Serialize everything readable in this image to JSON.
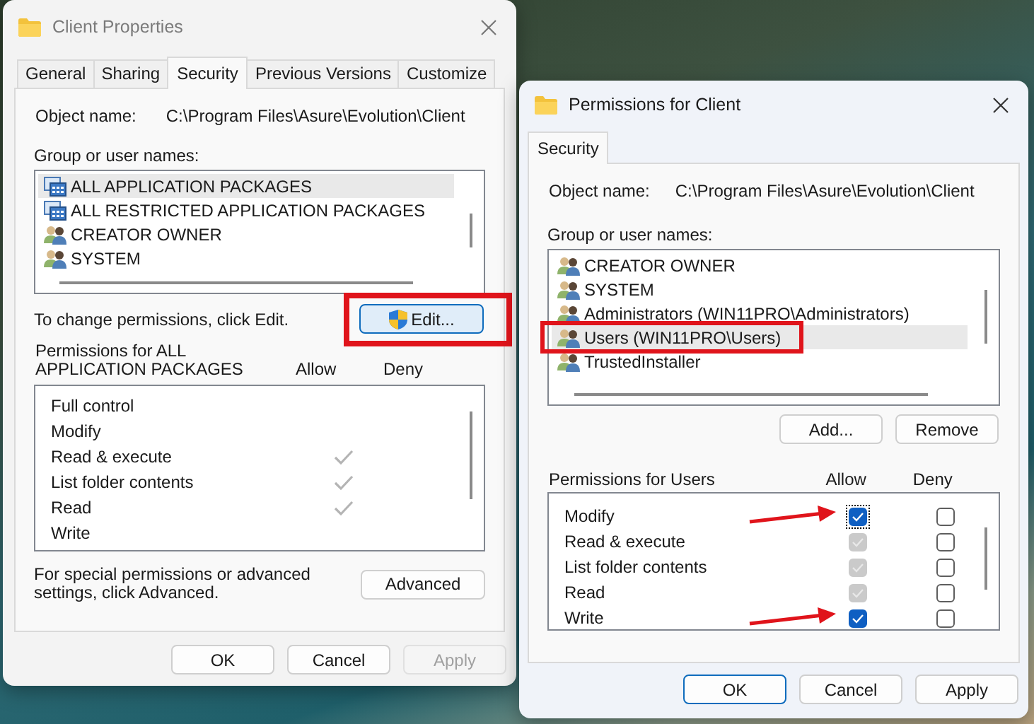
{
  "properties_window": {
    "title": "Client Properties",
    "active": false,
    "tabs": [
      {
        "label": "General",
        "selected": false
      },
      {
        "label": "Sharing",
        "selected": false
      },
      {
        "label": "Security",
        "selected": true
      },
      {
        "label": "Previous Versions",
        "selected": false
      },
      {
        "label": "Customize",
        "selected": false
      }
    ],
    "object_name_label": "Object name:",
    "object_name": "C:\\Program Files\\Asure\\Evolution\\Client",
    "group_label": "Group or user names:",
    "groups": [
      {
        "name": "ALL APPLICATION PACKAGES",
        "kind": "package",
        "selected": true
      },
      {
        "name": "ALL RESTRICTED APPLICATION PACKAGES",
        "kind": "package",
        "selected": false
      },
      {
        "name": "CREATOR OWNER",
        "kind": "users",
        "selected": false
      },
      {
        "name": "SYSTEM",
        "kind": "users",
        "selected": false
      }
    ],
    "change_hint": "To change permissions, click Edit.",
    "edit_button": {
      "label": "Edit...",
      "highlighted": true
    },
    "permissions_label": "Permissions for ALL APPLICATION PACKAGES",
    "allow_label": "Allow",
    "deny_label": "Deny",
    "permissions": [
      {
        "name": "Full control",
        "allow": false,
        "deny": false
      },
      {
        "name": "Modify",
        "allow": false,
        "deny": false
      },
      {
        "name": "Read & execute",
        "allow": true,
        "deny": false
      },
      {
        "name": "List folder contents",
        "allow": true,
        "deny": false
      },
      {
        "name": "Read",
        "allow": true,
        "deny": false
      },
      {
        "name": "Write",
        "allow": false,
        "deny": false
      }
    ],
    "advanced_hint": "For special permissions or advanced settings, click Advanced.",
    "advanced_button": "Advanced",
    "buttons": [
      {
        "label": "OK",
        "disabled": false
      },
      {
        "label": "Cancel",
        "disabled": false
      },
      {
        "label": "Apply",
        "disabled": true
      }
    ]
  },
  "permissions_window": {
    "title": "Permissions for Client",
    "active": true,
    "tabs": [
      {
        "label": "Security",
        "selected": true
      }
    ],
    "object_name_label": "Object name:",
    "object_name": "C:\\Program Files\\Asure\\Evolution\\Client",
    "group_label": "Group or user names:",
    "groups": [
      {
        "name": "CREATOR OWNER",
        "kind": "users",
        "selected": false,
        "highlighted": false
      },
      {
        "name": "SYSTEM",
        "kind": "users",
        "selected": false,
        "highlighted": false
      },
      {
        "name": "Administrators (WIN11PRO\\Administrators)",
        "kind": "users",
        "selected": false,
        "highlighted": false
      },
      {
        "name": "Users (WIN11PRO\\Users)",
        "kind": "users",
        "selected": true,
        "highlighted": true
      },
      {
        "name": "TrustedInstaller",
        "kind": "users",
        "selected": false,
        "highlighted": false
      }
    ],
    "add_button": "Add...",
    "remove_button": "Remove",
    "permissions_label": "Permissions for Users",
    "allow_label": "Allow",
    "deny_label": "Deny",
    "permissions": [
      {
        "name": "Modify",
        "allow": true,
        "inherited": false,
        "deny": false,
        "focused": true,
        "arrow": true
      },
      {
        "name": "Read & execute",
        "allow": true,
        "inherited": true,
        "deny": false,
        "focused": false
      },
      {
        "name": "List folder contents",
        "allow": true,
        "inherited": true,
        "deny": false,
        "focused": false
      },
      {
        "name": "Read",
        "allow": true,
        "inherited": true,
        "deny": false,
        "focused": false
      },
      {
        "name": "Write",
        "allow": true,
        "inherited": false,
        "deny": false,
        "focused": false,
        "arrow": true
      }
    ],
    "buttons": [
      {
        "label": "OK",
        "disabled": false,
        "default": true
      },
      {
        "label": "Cancel",
        "disabled": false,
        "default": false
      },
      {
        "label": "Apply",
        "disabled": false,
        "default": false
      }
    ]
  }
}
